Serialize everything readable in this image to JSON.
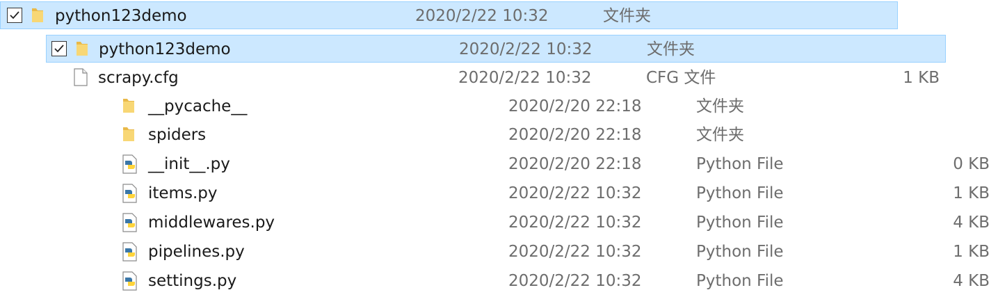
{
  "rows": [
    {
      "name": "python123demo",
      "date": "2020/2/22 10:32",
      "type": "文件夹",
      "size": "",
      "icon": "folder-icon",
      "selected": true
    },
    {
      "name": "python123demo",
      "date": "2020/2/22 10:32",
      "type": "文件夹",
      "size": "",
      "icon": "folder-icon",
      "selected": true
    },
    {
      "name": "scrapy.cfg",
      "date": "2020/2/22 10:32",
      "type": "CFG 文件",
      "size": "1 KB",
      "icon": "file-icon",
      "selected": false
    },
    {
      "name": "__pycache__",
      "date": "2020/2/20 22:18",
      "type": "文件夹",
      "size": "",
      "icon": "folder-icon",
      "selected": false
    },
    {
      "name": "spiders",
      "date": "2020/2/20 22:18",
      "type": "文件夹",
      "size": "",
      "icon": "folder-icon",
      "selected": false
    },
    {
      "name": "__init__.py",
      "date": "2020/2/20 22:18",
      "type": "Python File",
      "size": "0 KB",
      "icon": "python-file-icon",
      "selected": false
    },
    {
      "name": "items.py",
      "date": "2020/2/22 10:32",
      "type": "Python File",
      "size": "1 KB",
      "icon": "python-file-icon",
      "selected": false
    },
    {
      "name": "middlewares.py",
      "date": "2020/2/22 10:32",
      "type": "Python File",
      "size": "4 KB",
      "icon": "python-file-icon",
      "selected": false
    },
    {
      "name": "pipelines.py",
      "date": "2020/2/22 10:32",
      "type": "Python File",
      "size": "1 KB",
      "icon": "python-file-icon",
      "selected": false
    },
    {
      "name": "settings.py",
      "date": "2020/2/22 10:32",
      "type": "Python File",
      "size": "4 KB",
      "icon": "python-file-icon",
      "selected": false
    }
  ],
  "colors": {
    "selection_bg": "#cce8ff",
    "selection_border": "#99d1ff",
    "folder": "#f8d775",
    "python_blue": "#3b77a8",
    "python_yellow": "#ffd43b"
  }
}
